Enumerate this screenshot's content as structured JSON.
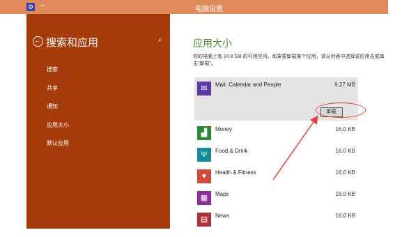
{
  "window": {
    "title": "电脑设置",
    "minimize_glyph": "–"
  },
  "sidebar": {
    "title": "搜索和应用",
    "items": [
      {
        "label": "搜索"
      },
      {
        "label": "共享"
      },
      {
        "label": "通知"
      },
      {
        "label": "应用大小"
      },
      {
        "label": "默认应用"
      }
    ]
  },
  "main": {
    "title": "应用大小",
    "description": "你的电脑上有 24.8 GB 的可用空间。如果要卸载某个应用，请从列表中选择该应用击或单击\"卸载\"。",
    "apps": [
      {
        "name": "Mail, Calendar and People",
        "size": "9.27 MB",
        "icon": "mail-icon",
        "color": "#5b3aa8",
        "glyph": "✉"
      },
      {
        "name": "Money",
        "size": "16.0 KB",
        "icon": "chart-icon",
        "color": "#2e8b32",
        "glyph": "▟"
      },
      {
        "name": "Food & Drink",
        "size": "16.0 KB",
        "icon": "fork-knife-icon",
        "color": "#138a9a",
        "glyph": "Ψ"
      },
      {
        "name": "Health & Fitness",
        "size": "16.0 KB",
        "icon": "heart-icon",
        "color": "#d04a3a",
        "glyph": "♥"
      },
      {
        "name": "Maps",
        "size": "16.0 KB",
        "icon": "map-icon",
        "color": "#8a2c9a",
        "glyph": "▦"
      },
      {
        "name": "News",
        "size": "16.0 KB",
        "icon": "news-icon",
        "color": "#b0303a",
        "glyph": "▤"
      }
    ],
    "uninstall_label": "卸载"
  },
  "colors": {
    "titlebar": "#e08a5c",
    "sidebar": "#a53a0a",
    "accent_green": "#4b8a2d",
    "annotation_red": "#e5403a"
  }
}
